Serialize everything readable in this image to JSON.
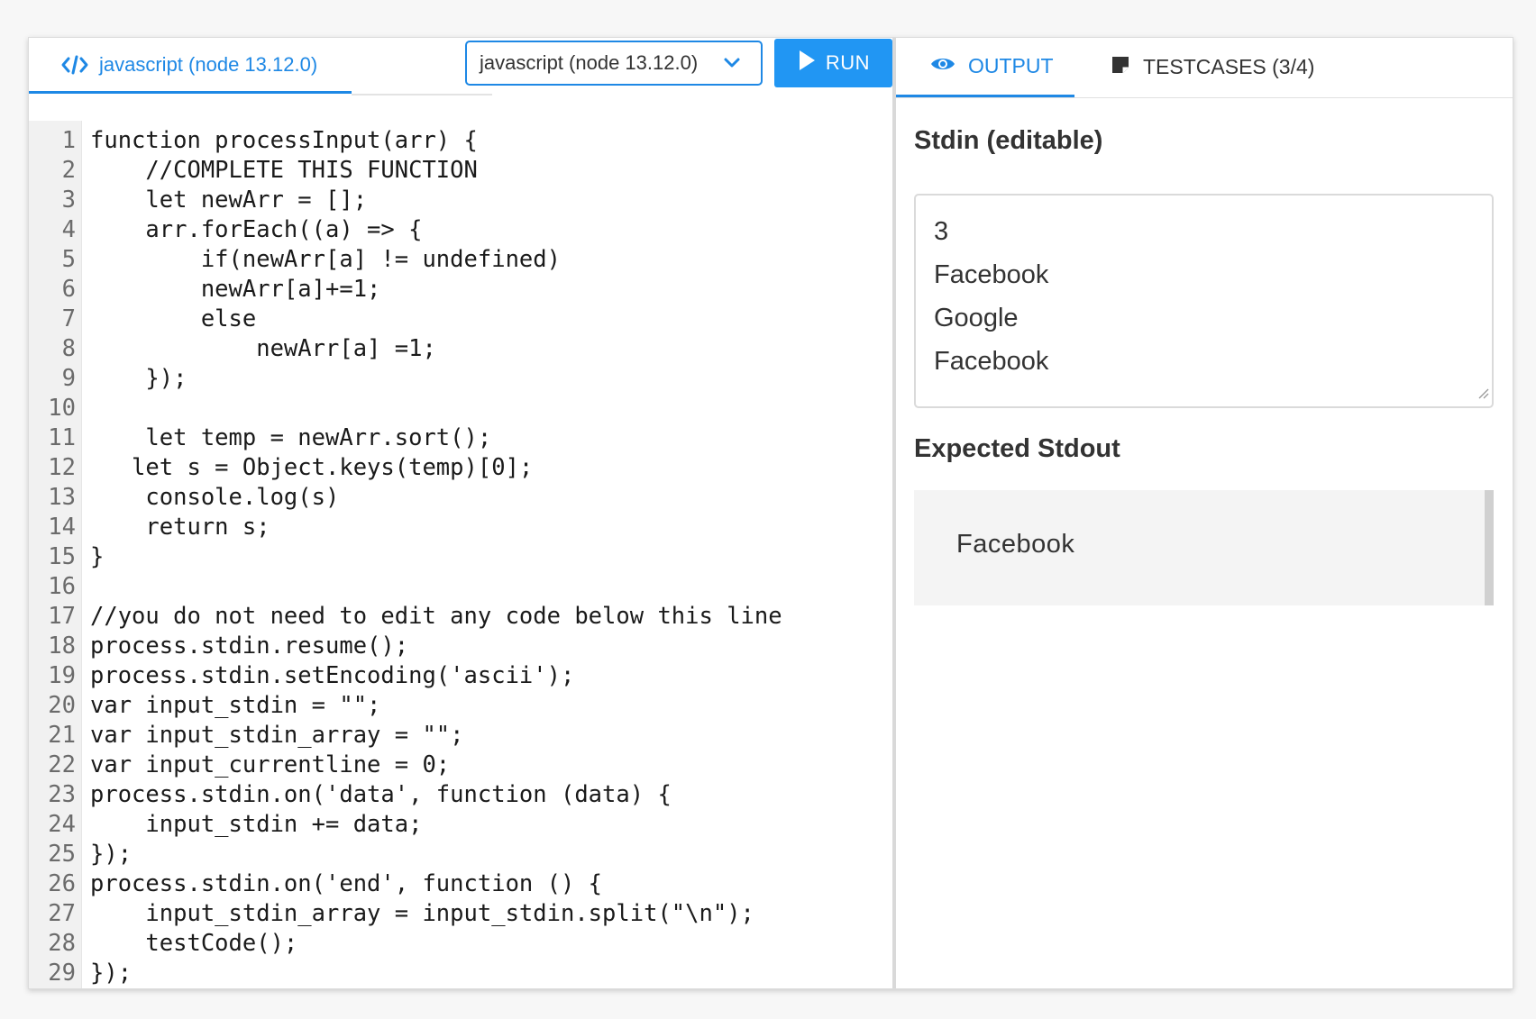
{
  "editor_tab": {
    "label": "javascript (node 13.12.0)",
    "icon": "code-icon"
  },
  "language_select": {
    "value": "javascript (node 13.12.0)",
    "icon": "chevron-down-icon"
  },
  "run_button": {
    "label": "RUN",
    "icon": "play-icon"
  },
  "code": [
    "function processInput(arr) {",
    "    //COMPLETE THIS FUNCTION",
    "    let newArr = [];",
    "    arr.forEach((a) => {",
    "        if(newArr[a] != undefined)",
    "        newArr[a]+=1;",
    "        else",
    "            newArr[a] =1;",
    "    });",
    "",
    "    let temp = newArr.sort();",
    "   let s = Object.keys(temp)[0];",
    "    console.log(s)",
    "    return s;",
    "}",
    "",
    "//you do not need to edit any code below this line",
    "process.stdin.resume();",
    "process.stdin.setEncoding('ascii');",
    "var input_stdin = \"\";",
    "var input_stdin_array = \"\";",
    "var input_currentline = 0;",
    "process.stdin.on('data', function (data) {",
    "    input_stdin += data;",
    "});",
    "process.stdin.on('end', function () {",
    "    input_stdin_array = input_stdin.split(\"\\n\");",
    "    testCode();",
    "});"
  ],
  "right_tabs": {
    "output": {
      "label": "OUTPUT",
      "icon": "eye-icon"
    },
    "testcases": {
      "label": "TESTCASES (3/4)",
      "icon": "note-icon"
    }
  },
  "stdin": {
    "title": "Stdin (editable)",
    "lines": [
      "3",
      "Facebook",
      "Google",
      "Facebook"
    ]
  },
  "expected": {
    "title": "Expected Stdout",
    "value": "Facebook"
  },
  "colors": {
    "accent": "#1e88e5",
    "run_bg": "#2196f3"
  }
}
